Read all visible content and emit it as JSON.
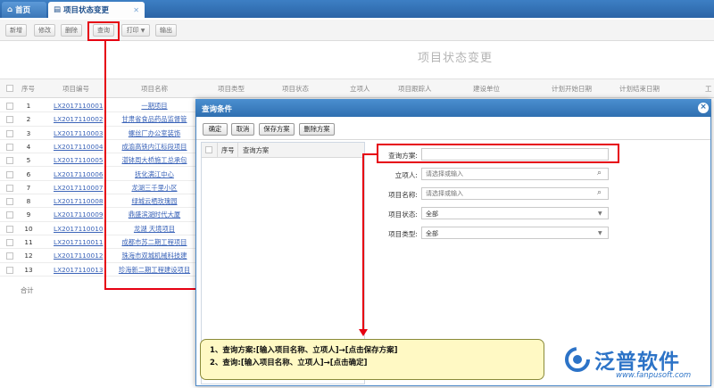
{
  "tabs": [
    {
      "label": "首页"
    },
    {
      "label": "项目状态变更"
    }
  ],
  "toolbar": {
    "buttons": [
      "新增",
      "修改",
      "删除",
      "查询",
      "打印",
      "输出"
    ]
  },
  "page_title": "项目状态变更",
  "grid": {
    "headers": [
      "序号",
      "项目编号",
      "项目名称",
      "项目类型",
      "项目状态",
      "立项人",
      "项目跟踪人",
      "建设单位",
      "计划开始日期",
      "计划结束日期",
      "工"
    ],
    "rows": [
      {
        "no": "1",
        "code": "LX2017110001",
        "name": "一期项目"
      },
      {
        "no": "2",
        "code": "LX2017110002",
        "name": "甘肃省食品药品监督管"
      },
      {
        "no": "3",
        "code": "LX2017110003",
        "name": "螺丝厂办公室装饰"
      },
      {
        "no": "4",
        "code": "LX2017110004",
        "name": "成渝高铁内江标段项目"
      },
      {
        "no": "5",
        "code": "LX2017110005",
        "name": "湛钵周大桥施工总承包"
      },
      {
        "no": "6",
        "code": "LX2017110006",
        "name": "抚化满江中心"
      },
      {
        "no": "7",
        "code": "LX2017110007",
        "name": "龙湖三千里小区"
      },
      {
        "no": "8",
        "code": "LX2017110008",
        "name": "绿城云栖玫瑰园"
      },
      {
        "no": "9",
        "code": "LX2017110009",
        "name": "鼎盛滨湖时代大厦"
      },
      {
        "no": "10",
        "code": "LX2017110010",
        "name": "龙湖 天境项目"
      },
      {
        "no": "11",
        "code": "LX2017110011",
        "name": "成都市苏二期工程项目"
      },
      {
        "no": "12",
        "code": "LX2017110012",
        "name": "珠海市双城机械科技建"
      },
      {
        "no": "13",
        "code": "LX2017110013",
        "name": "珍海新二期工程建设项目"
      }
    ],
    "total_label": "合计"
  },
  "dialog": {
    "title": "查询条件",
    "buttons": [
      "确定",
      "取消",
      "保存方案",
      "删除方案"
    ],
    "list_headers": [
      "序号",
      "查询方案"
    ],
    "fields": [
      {
        "label": "查询方案:",
        "value": "",
        "placeholder": ""
      },
      {
        "label": "立项人:",
        "value": "",
        "placeholder": "请选择或输入"
      },
      {
        "label": "项目名称:",
        "value": "",
        "placeholder": "请选择或输入"
      },
      {
        "label": "项目状态:",
        "value": "全部",
        "placeholder": ""
      },
      {
        "label": "项目类型:",
        "value": "全部",
        "placeholder": ""
      }
    ]
  },
  "note": {
    "line1": "1、查询方案:[输入项目名称、立项人]→[点击保存方案]",
    "line2": "2、查询:[输入项目名称、立项人]→[点击确定]"
  },
  "brand": {
    "name": "泛普软件",
    "url": "www.fanpusoft.com"
  },
  "colors": {
    "accent": "#2f6fb0",
    "annotation": "#e60012",
    "brand": "#2c73c7"
  }
}
